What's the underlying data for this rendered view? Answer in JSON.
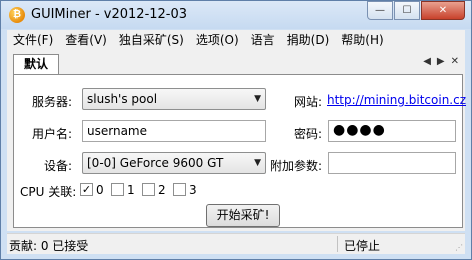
{
  "window": {
    "title": "GUIMiner - v2012-12-03",
    "icon": "bitcoin-icon"
  },
  "caption": {
    "minimize": "—",
    "maximize": "☐",
    "close": "✕"
  },
  "menu": [
    "文件(F)",
    "查看(V)",
    "独自采矿(S)",
    "选项(O)",
    "语言",
    "捐助(D)",
    "帮助(H)"
  ],
  "tabs": {
    "active": "默认",
    "prev": "◀",
    "next": "▶",
    "close": "✕"
  },
  "form": {
    "server_label": "服务器:",
    "server_value": "slush's pool",
    "website_label": "网站:",
    "website_link": "http://mining.bitcoin.cz",
    "username_label": "用户名:",
    "username_value": "username",
    "password_label": "密码:",
    "password_mask": "●●●●",
    "device_label": "设备:",
    "device_value": "[0-0] GeForce 9600 GT",
    "extra_label": "附加参数:",
    "extra_value": "",
    "cpu_label": "CPU 关联:",
    "cpu_checks": [
      {
        "label": "0",
        "checked": true
      },
      {
        "label": "1",
        "checked": false
      },
      {
        "label": "2",
        "checked": false
      },
      {
        "label": "3",
        "checked": false
      }
    ],
    "start_button": "开始采矿!"
  },
  "status": {
    "left": "贡献: 0 已接受",
    "right": "已停止"
  }
}
